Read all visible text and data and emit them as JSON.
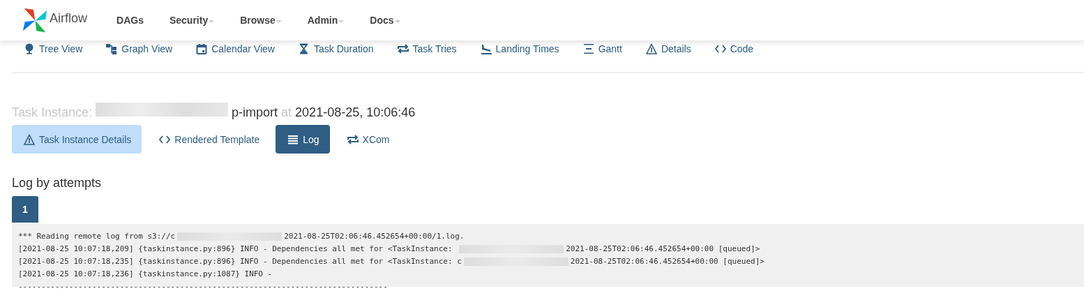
{
  "brand": "Airflow",
  "nav": [
    {
      "label": "DAGs",
      "dropdown": false
    },
    {
      "label": "Security",
      "dropdown": true
    },
    {
      "label": "Browse",
      "dropdown": true
    },
    {
      "label": "Admin",
      "dropdown": true
    },
    {
      "label": "Docs",
      "dropdown": true
    }
  ],
  "dag_views": [
    {
      "kind": "tree",
      "label": "Tree View"
    },
    {
      "kind": "graph",
      "label": "Graph View"
    },
    {
      "kind": "calendar",
      "label": "Calendar View"
    },
    {
      "kind": "duration",
      "label": "Task Duration"
    },
    {
      "kind": "tries",
      "label": "Task Tries"
    },
    {
      "kind": "landing",
      "label": "Landing Times"
    },
    {
      "kind": "gantt",
      "label": "Gantt"
    },
    {
      "kind": "details",
      "label": "Details"
    },
    {
      "kind": "code",
      "label": "Code"
    }
  ],
  "title": {
    "label": "Task Instance:",
    "task_tail": "p-import",
    "at": "at",
    "date": "2021-08-25, 10:06:46"
  },
  "task_tabs": [
    {
      "kind": "details",
      "label": "Task Instance Details",
      "selected": false,
      "highlighted": true
    },
    {
      "kind": "code",
      "label": "Rendered Template",
      "selected": false,
      "highlighted": false
    },
    {
      "kind": "log",
      "label": "Log",
      "selected": true,
      "highlighted": false
    },
    {
      "kind": "tries",
      "label": "XCom",
      "selected": false,
      "highlighted": false
    }
  ],
  "log_heading": "Log by attempts",
  "attempts": [
    {
      "label": "1",
      "selected": true
    }
  ],
  "log_lines": [
    {
      "before": "*** Reading remote log from s3://c",
      "after": "2021-08-25T02:06:46.452654+00:00/1.log."
    },
    {
      "before": "[2021-08-25 10:07:18,209] {taskinstance.py:896} INFO - Dependencies all met for <TaskInstance: ",
      "after": "2021-08-25T02:06:46.452654+00:00 [queued]>"
    },
    {
      "before": "[2021-08-25 10:07:18,235] {taskinstance.py:896} INFO - Dependencies all met for <TaskInstance: c",
      "after": "2021-08-25T02:06:46.452654+00:00 [queued]>"
    },
    {
      "before": "[2021-08-25 10:07:18,236] {taskinstance.py:1087} INFO -"
    },
    {
      "before": "--------------------------------------------------------------------------------"
    }
  ]
}
